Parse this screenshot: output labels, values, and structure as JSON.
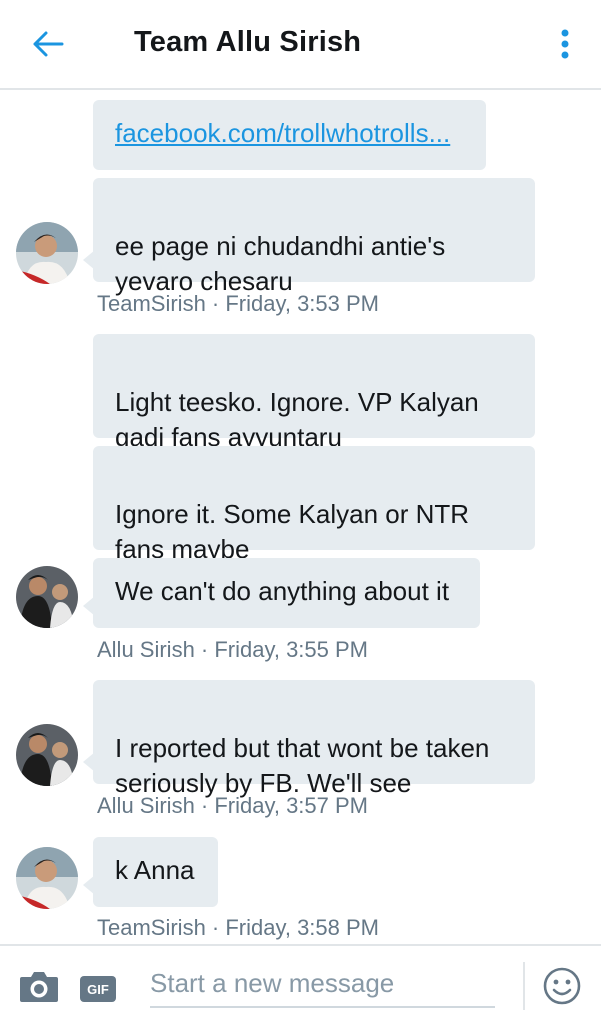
{
  "header": {
    "title": "Team Allu Sirish"
  },
  "messages": [
    {
      "text": "facebook.com/trollwhotrolls...",
      "is_link": true
    },
    {
      "text": "ee  page ni chudandhi antie's\nyevaro chesaru"
    },
    {
      "meta": "TeamSirish · Friday, 3:53 PM"
    },
    {
      "text": "Light teesko. Ignore. VP Kalyan\ngadi fans ayyuntaru"
    },
    {
      "text": "Ignore it. Some Kalyan or NTR\nfans maybe"
    },
    {
      "text": "We can't do anything about it"
    },
    {
      "meta": "Allu Sirish · Friday, 3:55 PM"
    },
    {
      "text": "I reported but that wont be taken\nseriously by FB. We'll see"
    },
    {
      "meta": "Allu Sirish · Friday, 3:57 PM"
    },
    {
      "text": "k Anna"
    },
    {
      "meta": "TeamSirish · Friday, 3:58 PM"
    }
  ],
  "composer": {
    "gif_label": "GIF",
    "placeholder": "Start a new message"
  },
  "colors": {
    "accent": "#1b95e0",
    "bubble": "#e6ecf0",
    "meta": "#657786"
  },
  "icons": {
    "back": "arrow-left-icon",
    "menu": "more-vertical-icon",
    "camera": "camera-icon",
    "emoji": "smiley-icon"
  }
}
